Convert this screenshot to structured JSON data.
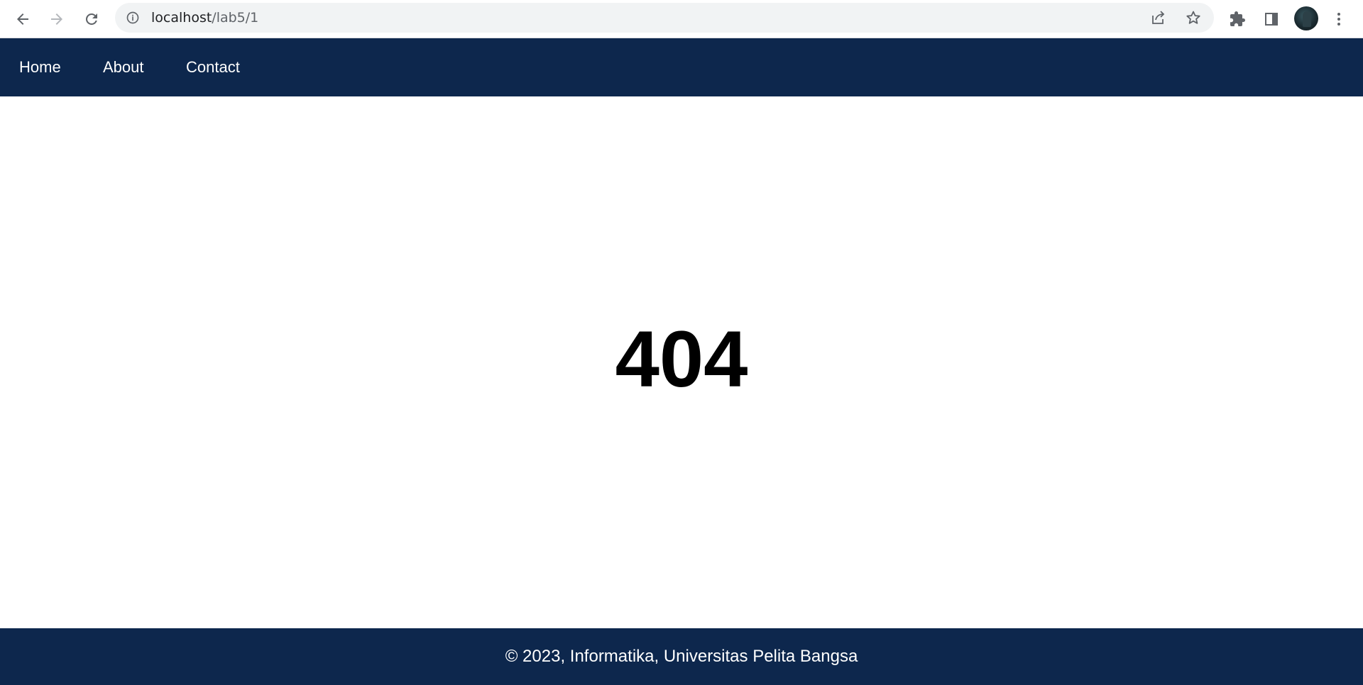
{
  "browser": {
    "url_host": "localhost",
    "url_path": "/lab5/1",
    "icons": {
      "back": "arrow-left-icon",
      "forward": "arrow-right-icon",
      "reload": "reload-icon",
      "info": "info-icon",
      "share": "share-icon",
      "bookmark": "star-icon",
      "extensions": "puzzle-icon",
      "side_panel": "side-panel-icon",
      "menu": "kebab-menu-icon"
    }
  },
  "nav": {
    "items": [
      {
        "label": "Home"
      },
      {
        "label": "About"
      },
      {
        "label": "Contact"
      }
    ]
  },
  "main": {
    "error_code": "404"
  },
  "footer": {
    "text": "© 2023, Informatika, Universitas Pelita Bangsa"
  },
  "colors": {
    "nav_bg": "#0d274d",
    "footer_bg": "#0d274d",
    "text_on_dark": "#ffffff"
  }
}
